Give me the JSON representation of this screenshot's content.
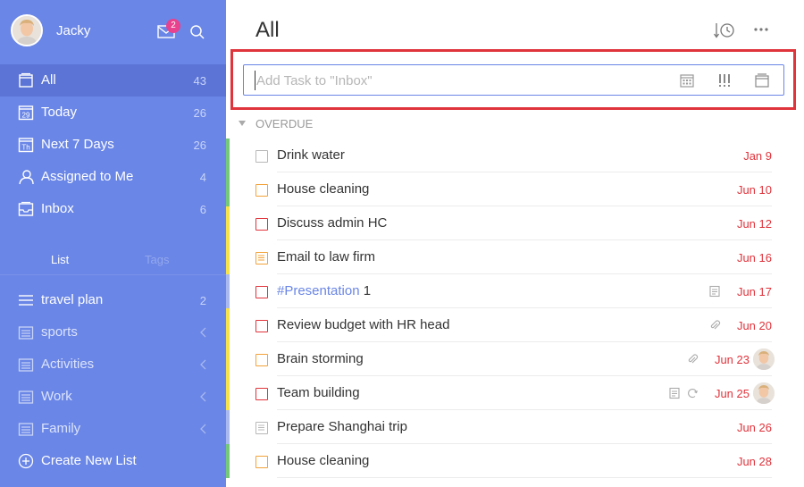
{
  "user": {
    "name": "Jacky",
    "mail_badge": "2"
  },
  "nav": [
    {
      "label": "All",
      "count": "43",
      "icon": "all-lists-icon"
    },
    {
      "label": "Today",
      "count": "26",
      "icon": "calendar-29-icon",
      "icon_text": "29"
    },
    {
      "label": "Next 7 Days",
      "count": "26",
      "icon": "calendar-th-icon",
      "icon_text": "Th"
    },
    {
      "label": "Assigned to Me",
      "count": "4",
      "icon": "person-icon"
    },
    {
      "label": "Inbox",
      "count": "6",
      "icon": "inbox-icon"
    }
  ],
  "tabs": {
    "list": "List",
    "tags": "Tags"
  },
  "lists": [
    {
      "label": "travel plan",
      "count": "2"
    },
    {
      "label": "sports"
    },
    {
      "label": "Activities"
    },
    {
      "label": "Work"
    },
    {
      "label": "Family"
    }
  ],
  "create_list": "Create New List",
  "main": {
    "title": "All",
    "add_placeholder": "Add Task to \"Inbox\"",
    "section": "OVERDUE"
  },
  "tasks": [
    {
      "title": "Drink water",
      "date": "Jan 9",
      "checkbox_color": "#b8b8b8",
      "bar_color": "#75c77a"
    },
    {
      "title": "House cleaning",
      "date": "Jun 10",
      "checkbox_color": "#f2a33a",
      "bar_color": "#75c77a"
    },
    {
      "title": "Discuss admin HC",
      "date": "Jun 12",
      "checkbox_color": "#e0343c",
      "bar_color": "#f7e24b"
    },
    {
      "title": "Email to law firm",
      "date": "Jun 16",
      "checkbox_color": "#f2a33a",
      "bar_color": "#f7e24b",
      "checklist": true
    },
    {
      "tag": "#Presentation",
      "title": " 1",
      "date": "Jun 17",
      "checkbox_color": "#e0343c",
      "bar_color": "#a9b9ef",
      "icons": [
        "note"
      ]
    },
    {
      "title": "Review budget with HR head",
      "date": "Jun 20",
      "checkbox_color": "#e0343c",
      "bar_color": "#f7e24b",
      "icons": [
        "attachment"
      ]
    },
    {
      "title": "Brain storming",
      "date": "Jun 23",
      "checkbox_color": "#f2a33a",
      "bar_color": "#f7e24b",
      "icons": [
        "attachment"
      ],
      "assignee": true
    },
    {
      "title": "Team building",
      "date": "Jun 25",
      "checkbox_color": "#e0343c",
      "bar_color": "#f7e24b",
      "icons": [
        "note",
        "repeat"
      ],
      "assignee": true
    },
    {
      "title": "Prepare Shanghai trip",
      "date": "Jun 26",
      "checkbox_color": "#b8b8b8",
      "bar_color": "#a9b9ef",
      "checklist": true
    },
    {
      "title": "House cleaning",
      "date": "Jun 28",
      "checkbox_color": "#f2a33a",
      "bar_color": "#75c77a"
    }
  ],
  "colors": {
    "sidebar": "#6a86e6",
    "sidebar_active": "#5b74d6",
    "overdue": "#e0343c",
    "highlight": "#e0343c",
    "badge": "#e8418d"
  }
}
